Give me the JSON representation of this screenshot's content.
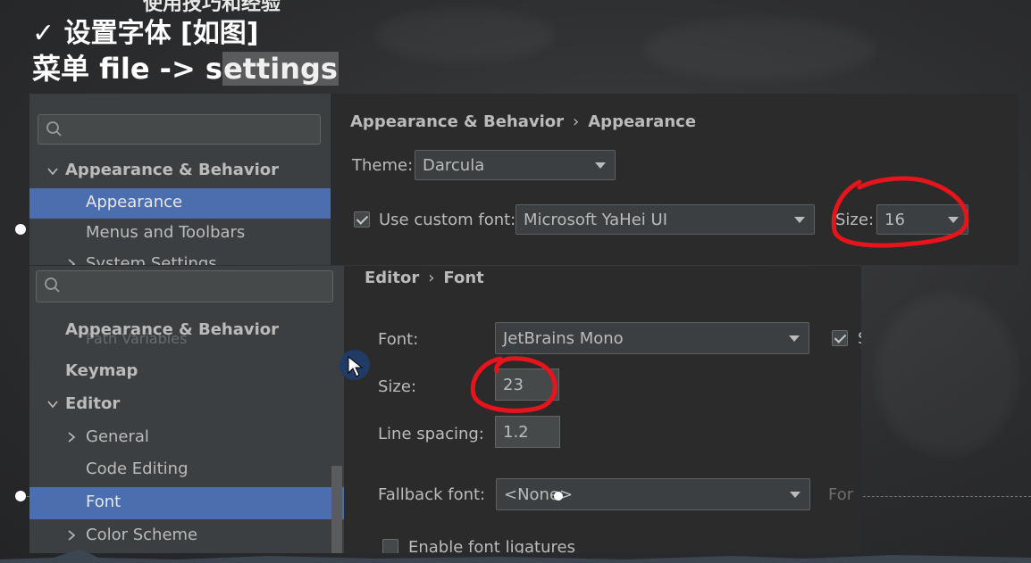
{
  "slide": {
    "cut_top_text": "使用技巧和经验",
    "check_glyph": "✓",
    "heading": "设置字体 [如图]",
    "menu_prefix": "菜单 file -> s",
    "menu_highlight": "ettings"
  },
  "panel_top": {
    "search": {
      "placeholder": "",
      "icon": "search-icon"
    },
    "tree": {
      "section": "Appearance & Behavior",
      "selected": "Appearance",
      "item2": "Menus and Toolbars",
      "item3_cut": "System Settings"
    },
    "breadcrumb": {
      "part1": "Appearance & Behavior",
      "separator": "›",
      "part2": "Appearance"
    },
    "theme": {
      "label": "Theme:",
      "value": "Darcula"
    },
    "custom_font": {
      "checked": true,
      "label": "Use custom font:",
      "value": "Microsoft YaHei UI"
    },
    "size": {
      "label": "Size:",
      "value": "16"
    }
  },
  "panel_bottom": {
    "search": {
      "placeholder": "",
      "icon": "search-icon"
    },
    "tree": {
      "section": "Appearance & Behavior",
      "ghost": "Path Variables",
      "keymap": "Keymap",
      "editor": "Editor",
      "general": "General",
      "code_editing": "Code Editing",
      "font": "Font",
      "color_scheme": "Color Scheme"
    },
    "breadcrumb": {
      "part1": "Editor",
      "separator": "›",
      "part2": "Font"
    },
    "font": {
      "label": "Font:",
      "value": "JetBrains Mono",
      "extra_checked": true,
      "extra_label_cut": "S"
    },
    "size": {
      "label": "Size:",
      "value": "23"
    },
    "line_spacing": {
      "label": "Line spacing:",
      "value": "1.2"
    },
    "fallback": {
      "label": "Fallback font:",
      "value": "<None>",
      "extra_cut": "For"
    },
    "ligatures": {
      "label": "Enable font ligatures",
      "checked": false
    }
  },
  "colors": {
    "selection": "#4b6eaf",
    "annotation_red": "#e8141c",
    "panel_bg": "#2b2b2b",
    "sidebar_bg": "#3c3f41"
  }
}
